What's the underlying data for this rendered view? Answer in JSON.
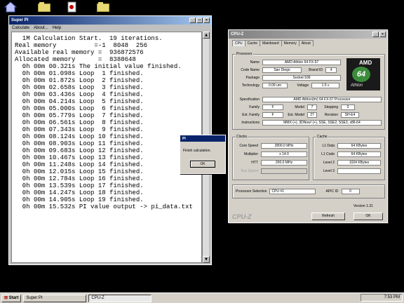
{
  "desktop": {
    "icons": [
      "home-icon",
      "folder-icon",
      "document-icon",
      "folder-icon"
    ]
  },
  "superpi": {
    "title": "Super PI",
    "menu": [
      "Calculate",
      "About...",
      "Help"
    ],
    "lines": [
      "  1M Calculation Start.  19 iterations.",
      "Real memory          =-1  8048  256",
      "Available real memory =  936872576",
      "Allocated memory      =  8388648",
      "  0h 00m 00.321s The initial value finished.",
      "  0h 00m 01.098s Loop  1 finished.",
      "  0h 00m 01.872s Loop  2 finished.",
      "  0h 00m 02.658s Loop  3 finished.",
      "  0h 00m 03.436s Loop  4 finished.",
      "  0h 00m 04.214s Loop  5 finished.",
      "  0h 00m 05.000s Loop  6 finished.",
      "  0h 00m 05.779s Loop  7 finished.",
      "  0h 00m 06.561s Loop  8 finished.",
      "  0h 00m 07.343s Loop  9 finished.",
      "  0h 00m 08.124s Loop 10 finished.",
      "  0h 00m 08.903s Loop 11 finished.",
      "  0h 00m 09.683s Loop 12 finished.",
      "  0h 00m 10.467s Loop 13 finished.",
      "  0h 00m 11.248s Loop 14 finished.",
      "  0h 00m 12.015s Loop 15 finished.",
      "  0h 00m 12.784s Loop 16 finished.",
      "  0h 00m 13.539s Loop 17 finished.",
      "  0h 00m 14.247s Loop 18 finished.",
      "  0h 00m 14.905s Loop 19 finished.",
      "  0h 00m 15.532s PI value output -> pi_data.txt"
    ]
  },
  "dialog": {
    "title": "PI",
    "message": "Finish calculation.",
    "ok": "OK"
  },
  "cpuz": {
    "title": "CPU-Z",
    "tabs": [
      "CPU",
      "Cache",
      "Mainboard",
      "Memory",
      "About"
    ],
    "processor_label": "Processor",
    "name_label": "Name",
    "name": "AMD Athlon 64 FX-57",
    "codename_label": "Code Name",
    "codename": "San Diego",
    "brandid_label": "Brand ID",
    "brandid": "4",
    "package_label": "Package",
    "package": "Socket 939",
    "technology_label": "Technology",
    "technology": "0.09 um",
    "voltage_label": "Voltage",
    "voltage": "1.5 v",
    "spec_label": "Specification",
    "spec": "AMD Athlon(tm) 64 FX-57 Processor",
    "family_label": "Family",
    "family": "F",
    "model_label": "Model",
    "model": "7",
    "stepping_label": "Stepping",
    "stepping": "0",
    "extfamily_label": "Ext. Family",
    "extfamily": "F",
    "extmodel_label": "Ext. Model",
    "extmodel": "27",
    "revision_label": "Revision",
    "revision": "SH-E4",
    "instr_label": "Instructions",
    "instr": "MMX (+), 3DNow! (+), SSE, SSE2, SSE3, x86-64",
    "clocks_label": "Clocks",
    "corespeed_label": "Core Speed",
    "corespeed": "2800.0 MHz",
    "multiplier_label": "Multiplier",
    "multiplier": "x 14.0",
    "htt_label": "HTT",
    "htt": "200.0 MHz",
    "busspeed_label": "Bus Speed",
    "busspeed": "",
    "cache_label": "Cache",
    "l1data_label": "L1 Data",
    "l1data": "64 KBytes",
    "l1code_label": "L1 Code",
    "l1code": "64 KBytes",
    "level2_label": "Level 2",
    "level2": "1024 KBytes",
    "level3_label": "Level 3",
    "level3": "",
    "selection_label": "Processor Selection",
    "selection": "CPU #1",
    "apicid_label": "APIC ID",
    "apicid": "0",
    "version": "Version 1.31",
    "brand": "CPU-Z",
    "refresh": "Refresh",
    "ok": "OK",
    "logo_brand": "AMD",
    "logo_num": "64",
    "logo_name": "Athlon"
  },
  "taskbar": {
    "start": "Start",
    "tasks": [
      "Super PI",
      "CPU-Z"
    ],
    "clock": "7:53 PM"
  }
}
